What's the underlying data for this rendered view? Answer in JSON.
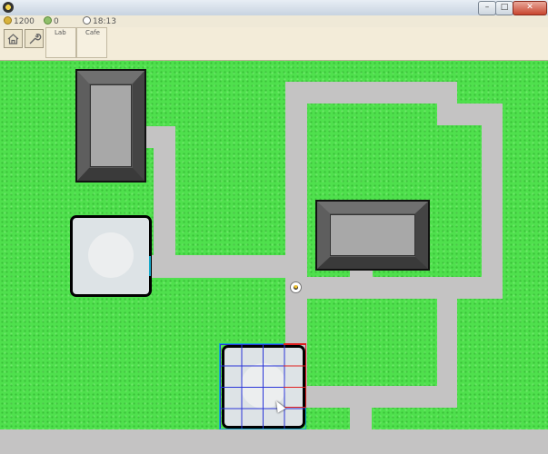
{
  "window": {
    "title": "",
    "buttons": {
      "minimize": "–",
      "maximize": "□",
      "close": "✕"
    }
  },
  "status": {
    "money": "1200",
    "population": "0",
    "time": "18:13",
    "icons": {
      "money": "coin-icon",
      "population": "person-icon",
      "time": "clock-icon"
    }
  },
  "toolbar": {
    "tools": [
      {
        "name": "home-icon"
      },
      {
        "name": "wrench-icon"
      }
    ],
    "tabs": [
      {
        "label": "Lab"
      },
      {
        "label": "Cafe"
      }
    ]
  },
  "map": {
    "colors": {
      "grass": "#4fe04d",
      "road": "#c4c3c3",
      "building_wall": "#555555",
      "building_roof": "#a8a8a8",
      "plot_fill": "#dde3e6",
      "placement_grid": "#2a36d8",
      "placement_invalid": "#e02020"
    },
    "placement_preview": {
      "valid_columns": 3,
      "invalid_columns": 1,
      "rows": 4
    }
  }
}
